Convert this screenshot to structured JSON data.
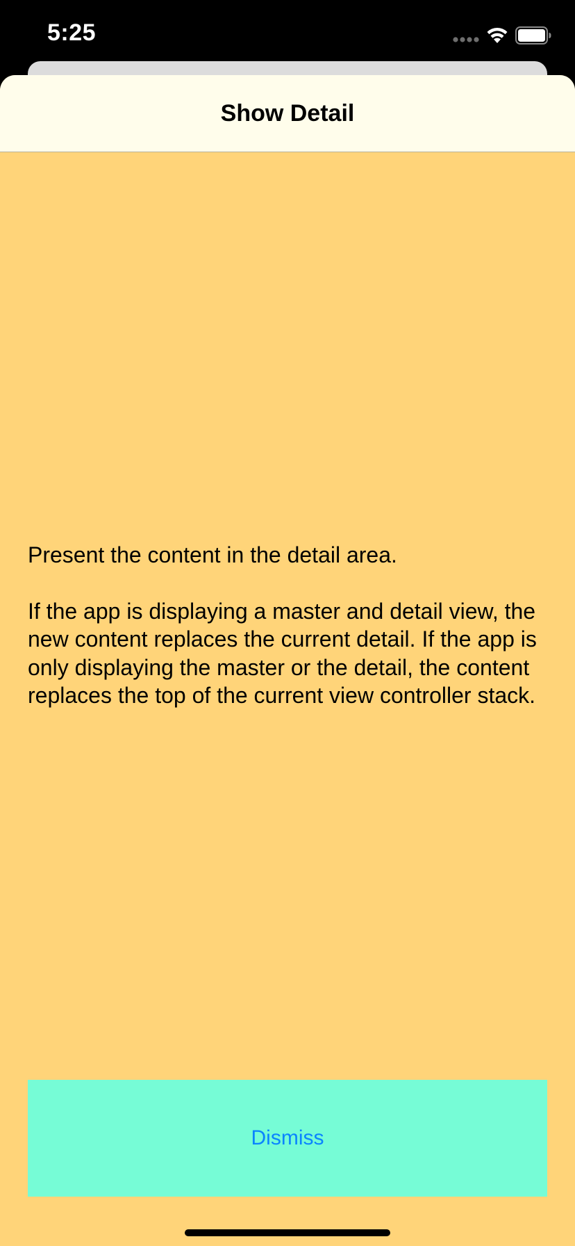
{
  "status_bar": {
    "time": "5:25",
    "icons": [
      "signal-icon",
      "wifi-icon",
      "battery-icon"
    ]
  },
  "nav": {
    "title": "Show Detail"
  },
  "content": {
    "paragraph_1": "Present the content in the detail area.",
    "paragraph_2": "If the app is displaying a master and detail view, the new content replaces the current detail. If the app is only displaying the master or the detail, the content replaces the top of the current view controller stack."
  },
  "dismiss": {
    "label": "Dismiss"
  },
  "colors": {
    "background": "#ffd479",
    "nav_background": "#fffdeb",
    "button_background": "#76fcd6",
    "button_text": "#0a84ff"
  }
}
